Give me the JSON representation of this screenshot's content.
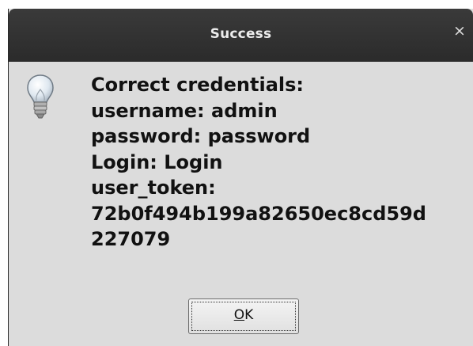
{
  "window": {
    "title": "Success",
    "close_glyph": "×"
  },
  "icon": {
    "name": "lightbulb-icon"
  },
  "message": {
    "lines": [
      "Correct credentials:",
      "username: admin",
      "password: password",
      "Login: Login",
      "user_token:",
      "72b0f494b199a82650ec8cd59d",
      "227079"
    ]
  },
  "buttons": {
    "ok_mnemonic": "O",
    "ok_rest": "K"
  },
  "colors": {
    "titlebar": "#2f2f2f",
    "dialog_bg": "#dcdcdc",
    "text": "#111111"
  }
}
